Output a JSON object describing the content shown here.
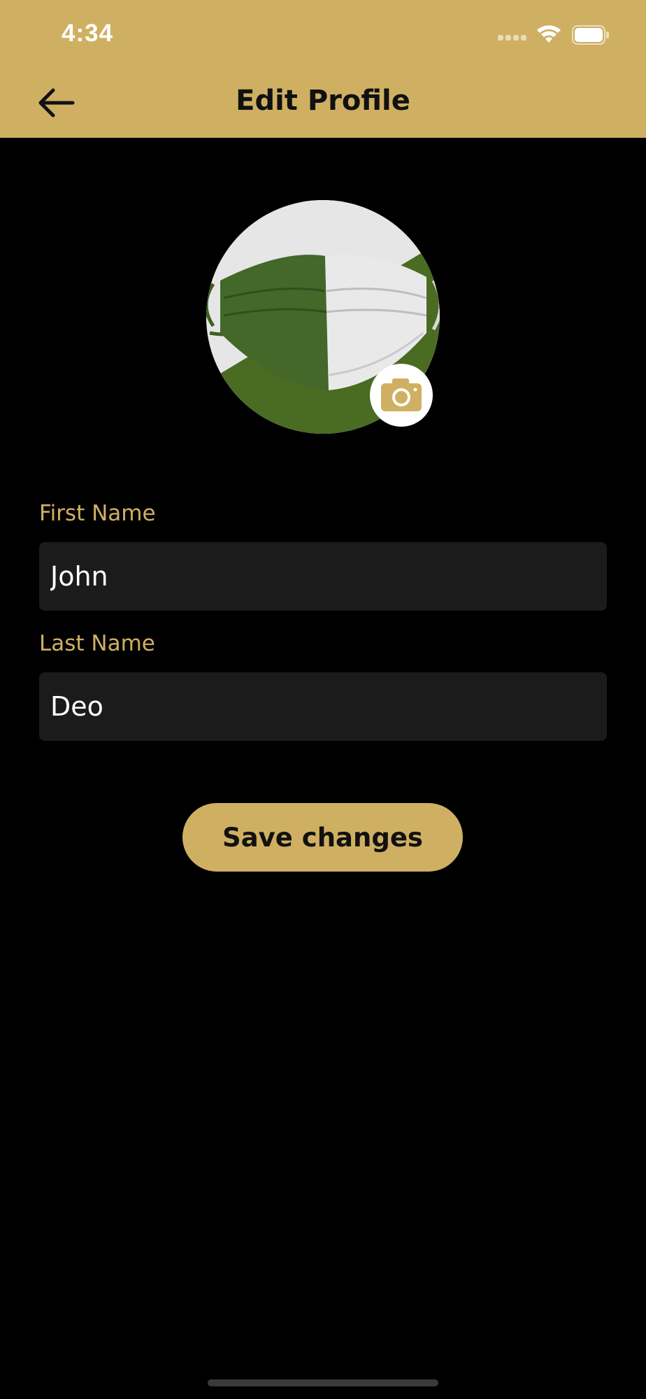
{
  "status_bar": {
    "time": "4:34"
  },
  "header": {
    "title": "Edit Profile"
  },
  "form": {
    "first_name": {
      "label": "First Name",
      "value": "John"
    },
    "last_name": {
      "label": "Last Name",
      "value": "Deo"
    }
  },
  "actions": {
    "save_label": "Save changes"
  },
  "colors": {
    "accent": "#CFB062",
    "background": "#000000",
    "field": "#1B1B1B"
  },
  "icons": [
    "back-arrow-icon",
    "camera-icon",
    "wifi-icon",
    "battery-icon",
    "signal-icon"
  ]
}
